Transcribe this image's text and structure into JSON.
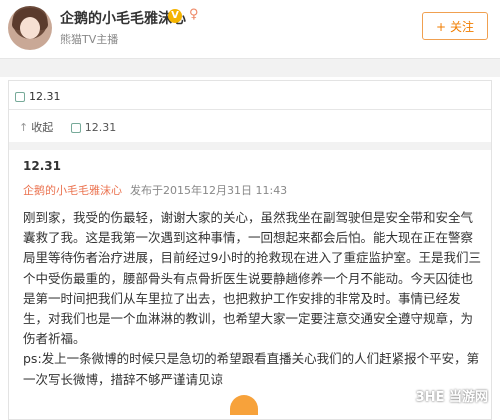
{
  "header": {
    "username": "企鹅的小毛毛雅沫心",
    "verify_label": "熊猫TV主播",
    "follow_label": "关注",
    "follow_plus": "+",
    "vip_badge": "V"
  },
  "card": {
    "tag_label": "12.31",
    "toolbar": {
      "collapse_label": "收起",
      "tag_label": "12.31"
    },
    "post": {
      "title": "12.31",
      "author": "企鹅的小毛毛雅沫心",
      "published": "发布于2015年12月31日 11:43",
      "paragraphs": [
        "刚到家，我受的伤最轻，谢谢大家的关心，虽然我坐在副驾驶但是安全带和安全气囊救了我。这是我第一次遇到这种事情，一回想起来都会后怕。能大现在正在警察局里等待伤者治疗进展，目前经过9小时的抢救现在进入了重症监护室。王是我们三个中受伤最重的，腰部骨头有点骨折医生说要静趟修养一个月不能动。今天囚徒也是第一时间把我们从车里拉了出去，也把救护工作安排的非常及时。事情已经发生，对我们也是一个血淋淋的教训，也希望大家一定要注意交通安全遵守规章，为伤者祈福。",
        "ps:发上一条微博的时候只是急切的希望跟看直播关心我们的人们赶紧报个平安，第一次写长微博，措辞不够严谨请见谅"
      ]
    }
  },
  "watermark": "3HE 当游网",
  "colors": {
    "accent": "#eb7350",
    "follow_border": "#f0a050",
    "background_band": "#f2f2f2"
  },
  "icons": [
    "user-avatar",
    "vip-badge-icon",
    "female-icon",
    "tag-icon",
    "collapse-icon",
    "tag-small-icon"
  ]
}
